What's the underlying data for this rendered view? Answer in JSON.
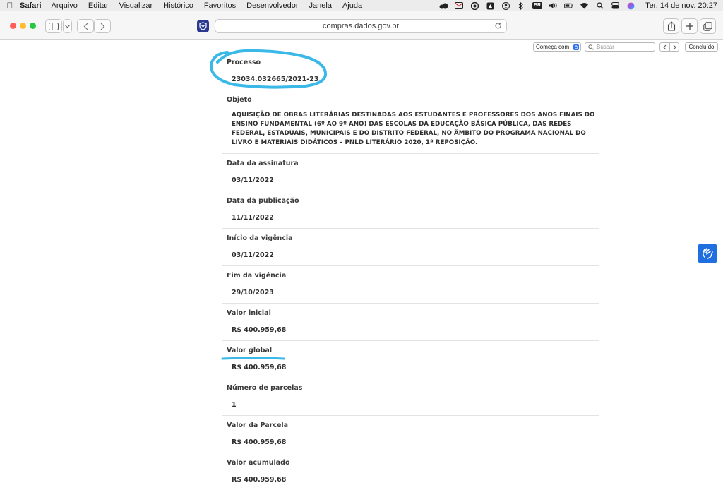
{
  "menubar": {
    "app_name": "Safari",
    "items": [
      "Arquivo",
      "Editar",
      "Visualizar",
      "Histórico",
      "Favoritos",
      "Desenvolvedor",
      "Janela",
      "Ajuda"
    ],
    "keyboard_badge": "BR",
    "clock": "Ter. 14 de nov.  20:27"
  },
  "browser": {
    "url": "compras.dados.gov.br"
  },
  "findbar": {
    "mode": "Começa com",
    "search_placeholder": "Buscar",
    "done_label": "Concluído"
  },
  "record": {
    "fields": [
      {
        "label": "Processo",
        "value": "23034.032665/2021-23"
      },
      {
        "label": "Objeto",
        "value": "AQUISIÇÃO DE OBRAS LITERÁRIAS DESTINADAS AOS ESTUDANTES E PROFESSORES DOS ANOS FINAIS DO ENSINO FUNDAMENTAL (6º AO 9º ANO) DAS ESCOLAS DA EDUCAÇÃO BÁSICA PÚBLICA, DAS REDES FEDERAL, ESTADUAIS, MUNICIPAIS E DO DISTRITO FEDERAL, NO ÂMBITO DO PROGRAMA NACIONAL DO LIVRO E MATERIAIS DIDÁTICOS – PNLD LITERÁRIO 2020, 1ª REPOSIÇÃO."
      },
      {
        "label": "Data da assinatura",
        "value": "03/11/2022"
      },
      {
        "label": "Data da publicação",
        "value": "11/11/2022"
      },
      {
        "label": "Início da vigência",
        "value": "03/11/2022"
      },
      {
        "label": "Fim da vigência",
        "value": "29/10/2023"
      },
      {
        "label": "Valor inicial",
        "value": "R$ 400.959,68"
      },
      {
        "label": "Valor global",
        "value": "R$ 400.959,68"
      },
      {
        "label": "Número de parcelas",
        "value": "1"
      },
      {
        "label": "Valor da Parcela",
        "value": "R$ 400.959,68"
      },
      {
        "label": "Valor acumulado",
        "value": "R$ 400.959,68"
      }
    ]
  },
  "colors": {
    "annotation": "#3ab8e8",
    "accent": "#1f6fe0"
  }
}
